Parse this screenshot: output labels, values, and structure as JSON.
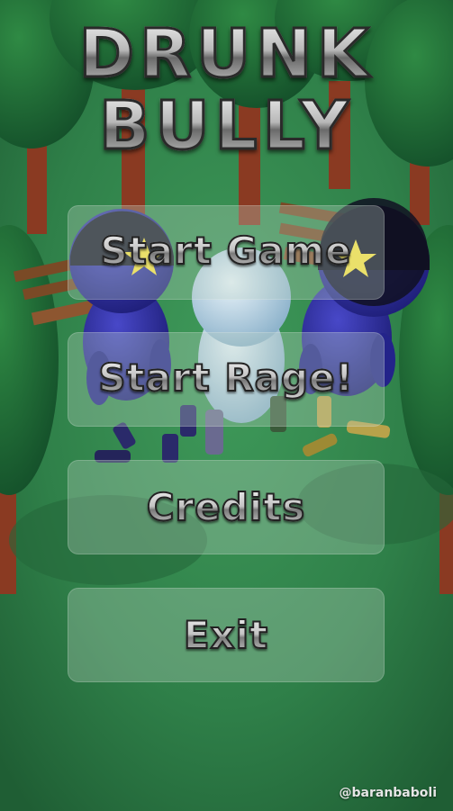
{
  "title": {
    "line1": "DRUNK",
    "line2": "BULLY"
  },
  "menu": {
    "start_game": "Start Game",
    "start_rage": "Start Rage!",
    "credits": "Credits",
    "exit": "Exit"
  },
  "watermark": "@baranbaboli",
  "colors": {
    "ground": "#2e7a45",
    "tree_foliage": "#1f6b34",
    "tree_trunk": "#8a3a22",
    "bench": "#7a4a26",
    "bully_body": "#2f2fa0",
    "player_body": "#cfe3ef",
    "star": "#ffe640",
    "button_fill": "rgba(190,210,195,0.32)"
  },
  "icons": [
    "star-icon",
    "bottle-icon",
    "tree-icon",
    "bench-icon"
  ]
}
